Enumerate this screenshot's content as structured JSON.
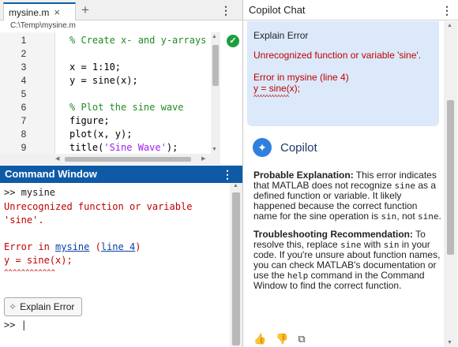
{
  "editor": {
    "tab_name": "mysine.m",
    "tab_close": "×",
    "tab_add": "+",
    "kebab": "⋮",
    "path": "C:\\Temp\\mysine.m",
    "status_icon": "check-circle-icon",
    "lines": [
      {
        "num": "1",
        "text": "% Create x- and y-arrays",
        "kind": "comment"
      },
      {
        "num": "2",
        "text": "",
        "kind": "code"
      },
      {
        "num": "3",
        "text": "x = 1:10;",
        "kind": "code"
      },
      {
        "num": "4",
        "text": "y = sine(x);",
        "kind": "code"
      },
      {
        "num": "5",
        "text": "",
        "kind": "code"
      },
      {
        "num": "6",
        "text": "% Plot the sine wave",
        "kind": "comment"
      },
      {
        "num": "7",
        "text": "figure;",
        "kind": "code"
      },
      {
        "num": "8",
        "text": "plot(x, y);",
        "kind": "code"
      },
      {
        "num": "9",
        "text_pre": "title(",
        "text_str": "'Sine Wave'",
        "text_post": ");",
        "kind": "string"
      }
    ]
  },
  "command_window": {
    "title": "Command Window",
    "kebab": "⋮",
    "prompt_cmd": ">> mysine",
    "error_line1": "Unrecognized function or variable",
    "error_line2": "'sine'.",
    "error_in": "Error in ",
    "error_fn": "mysine",
    "error_paren_open": " (",
    "error_line_link": "line 4",
    "error_paren_close": ")",
    "error_code": "y = sine(x);",
    "error_caret": "^^^^^^^^^^^^",
    "explain_button": "Explain Error",
    "prompt": ">>"
  },
  "copilot": {
    "title": "Copilot Chat",
    "kebab": "⋮",
    "user_msg_title": "Explain Error",
    "user_msg_error": "Unrecognized function or variable 'sine'.",
    "user_msg_error_in": "Error in mysine (line 4)",
    "user_msg_code": "y = sine(x);",
    "user_msg_caret": "^^^^^^^^^^^^",
    "brand": "Copilot",
    "probable_heading": "Probable Explanation:",
    "p1_a": " This error indicates that MATLAB does not recognize ",
    "p1_code1": "sine",
    "p1_b": " as a defined function or variable. It likely happened because the correct function name for the sine operation is ",
    "p1_code2": "sin",
    "p1_c": ", not ",
    "p1_code3": "sine",
    "p1_d": ".",
    "troubleshoot_heading": "Troubleshooting Recommendation:",
    "p2_a": " To resolve this, replace ",
    "p2_code1": "sine",
    "p2_b": " with ",
    "p2_code2": "sin",
    "p2_c": " in your code. If you're unsure about function names, you can check MATLAB's documentation or use the ",
    "p2_code3": "help",
    "p2_d": " command in the Command Window to find the correct function."
  },
  "colors": {
    "accent_blue": "#0e5aa7",
    "error_red": "#c00000",
    "comment_green": "#228b22",
    "string_purple": "#a020f0",
    "bubble_bg": "#dbe9fb"
  }
}
